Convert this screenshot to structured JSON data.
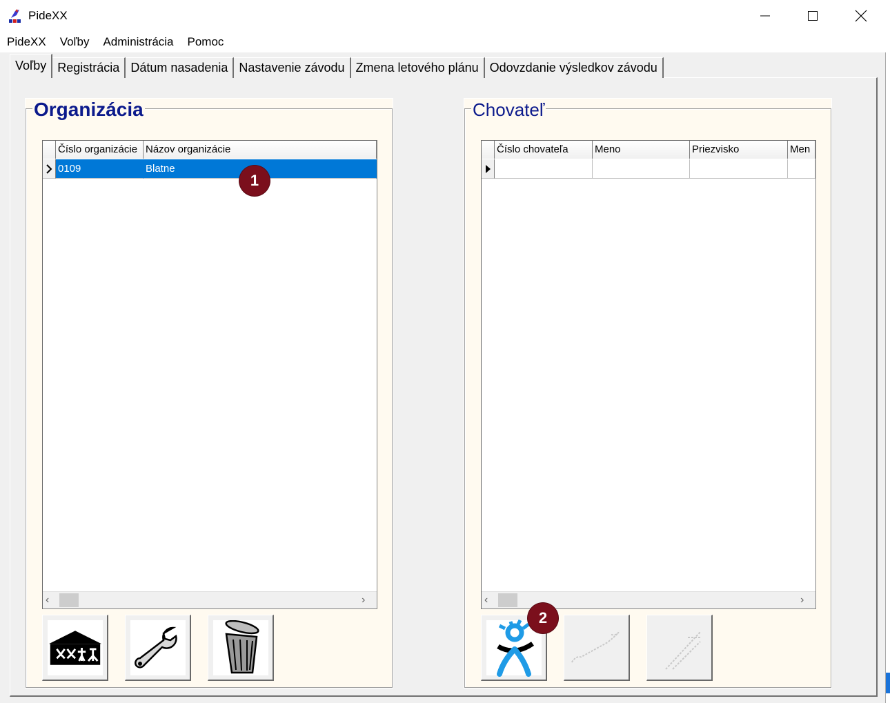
{
  "window": {
    "title": "PideXX"
  },
  "menu": [
    "PideXX",
    "Voľby",
    "Administrácia",
    "Pomoc"
  ],
  "tabs": [
    {
      "label": "Voľby",
      "active": true
    },
    {
      "label": "Registrácia",
      "active": false
    },
    {
      "label": "Dátum nasadenia",
      "active": false
    },
    {
      "label": "Nastavenie závodu",
      "active": false
    },
    {
      "label": "Zmena letového plánu",
      "active": false
    },
    {
      "label": "Odovzdanie výsledkov závodu",
      "active": false
    }
  ],
  "organization": {
    "title": "Organizácia",
    "columns": [
      "Číslo organizácie",
      "Názov organizácie"
    ],
    "rows": [
      {
        "number": "0109",
        "name": "Blatne",
        "selected": true
      }
    ],
    "buttons": [
      {
        "icon": "building-icon",
        "enabled": true
      },
      {
        "icon": "wrench-icon",
        "enabled": true
      },
      {
        "icon": "trash-can-icon",
        "enabled": true
      }
    ]
  },
  "breeder": {
    "title": "Chovateľ",
    "columns": [
      "Číslo chovateľa",
      "Meno",
      "Priezvisko",
      "Men"
    ],
    "buttons": [
      {
        "icon": "person-icon",
        "enabled": true
      },
      {
        "icon": "edit-icon",
        "enabled": false
      },
      {
        "icon": "delete-icon",
        "enabled": false
      }
    ]
  },
  "callouts": [
    "1",
    "2"
  ],
  "colors": {
    "selection": "#0078d7",
    "group_title": "#0c1a8c",
    "group_bg": "#fffaf0",
    "badge": "#7b0f1c"
  }
}
